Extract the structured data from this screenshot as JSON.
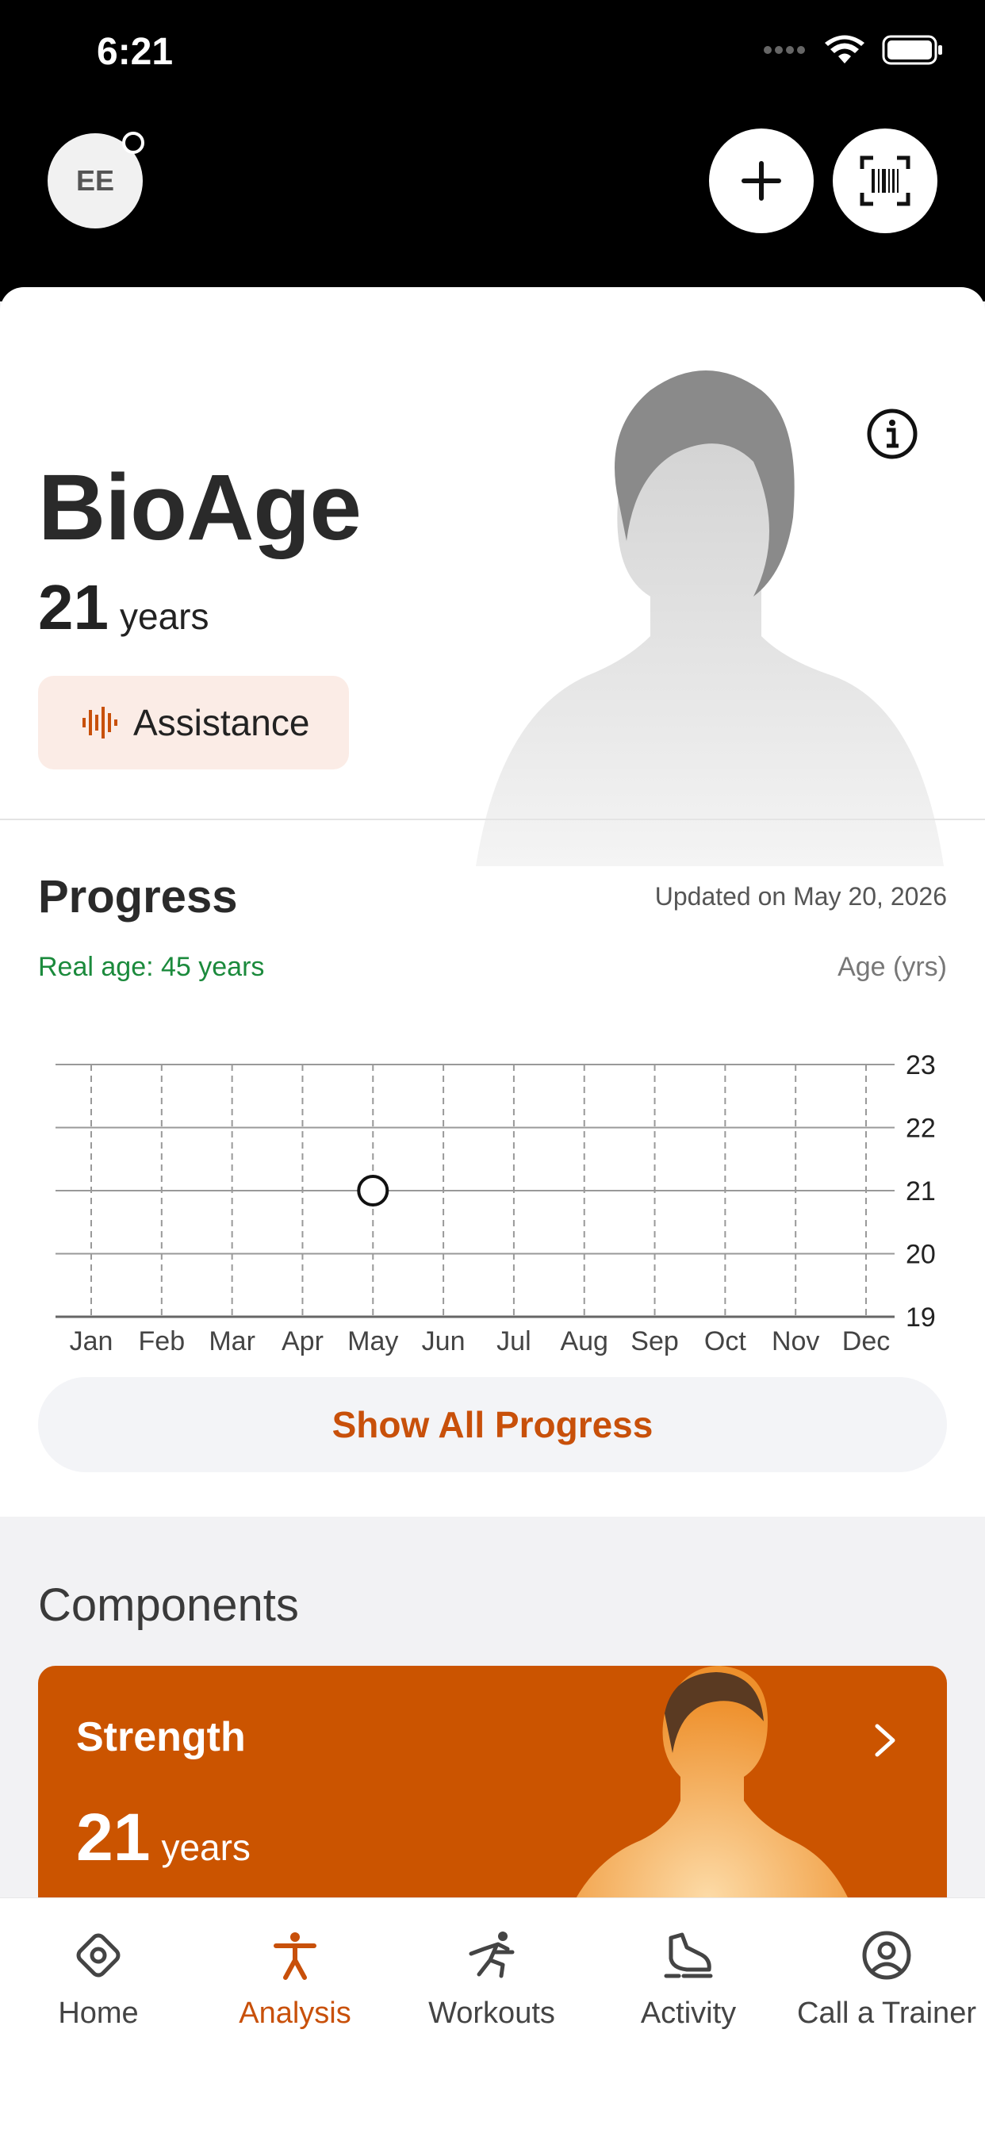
{
  "status_bar": {
    "time": "6:21"
  },
  "header": {
    "avatar_initials": "EE",
    "add_icon": "plus-icon",
    "scan_icon": "barcode-scan-icon"
  },
  "bioage": {
    "title": "BioAge",
    "value": "21",
    "unit": "years",
    "assistance_label": "Assistance",
    "info_icon": "info-icon"
  },
  "progress": {
    "title": "Progress",
    "updated": "Updated on May 20, 2026",
    "real_age": "Real age: 45 years",
    "axis_label": "Age (yrs)",
    "show_all_label": "Show All Progress"
  },
  "chart_data": {
    "type": "scatter",
    "categories": [
      "Jan",
      "Feb",
      "Mar",
      "Apr",
      "May",
      "Jun",
      "Jul",
      "Aug",
      "Sep",
      "Oct",
      "Nov",
      "Dec"
    ],
    "points": [
      {
        "x": "May",
        "y": 21
      }
    ],
    "ylim": [
      19,
      23
    ],
    "yticks": [
      23,
      22,
      21,
      20,
      19
    ],
    "ylabel": "Age (yrs)",
    "grid": true
  },
  "components": {
    "title": "Components",
    "strength": {
      "label": "Strength",
      "value": "21",
      "unit": "years"
    }
  },
  "tabs": [
    {
      "label": "Home",
      "icon": "home-icon",
      "active": false
    },
    {
      "label": "Analysis",
      "icon": "body-icon",
      "active": true
    },
    {
      "label": "Workouts",
      "icon": "workout-icon",
      "active": false
    },
    {
      "label": "Activity",
      "icon": "shoe-icon",
      "active": false
    },
    {
      "label": "Call a Trainer",
      "icon": "trainer-icon",
      "active": false
    }
  ],
  "colors": {
    "accent": "#c8500a",
    "strength_card": "#cb5400",
    "real_age_green": "#1b8a3c"
  }
}
